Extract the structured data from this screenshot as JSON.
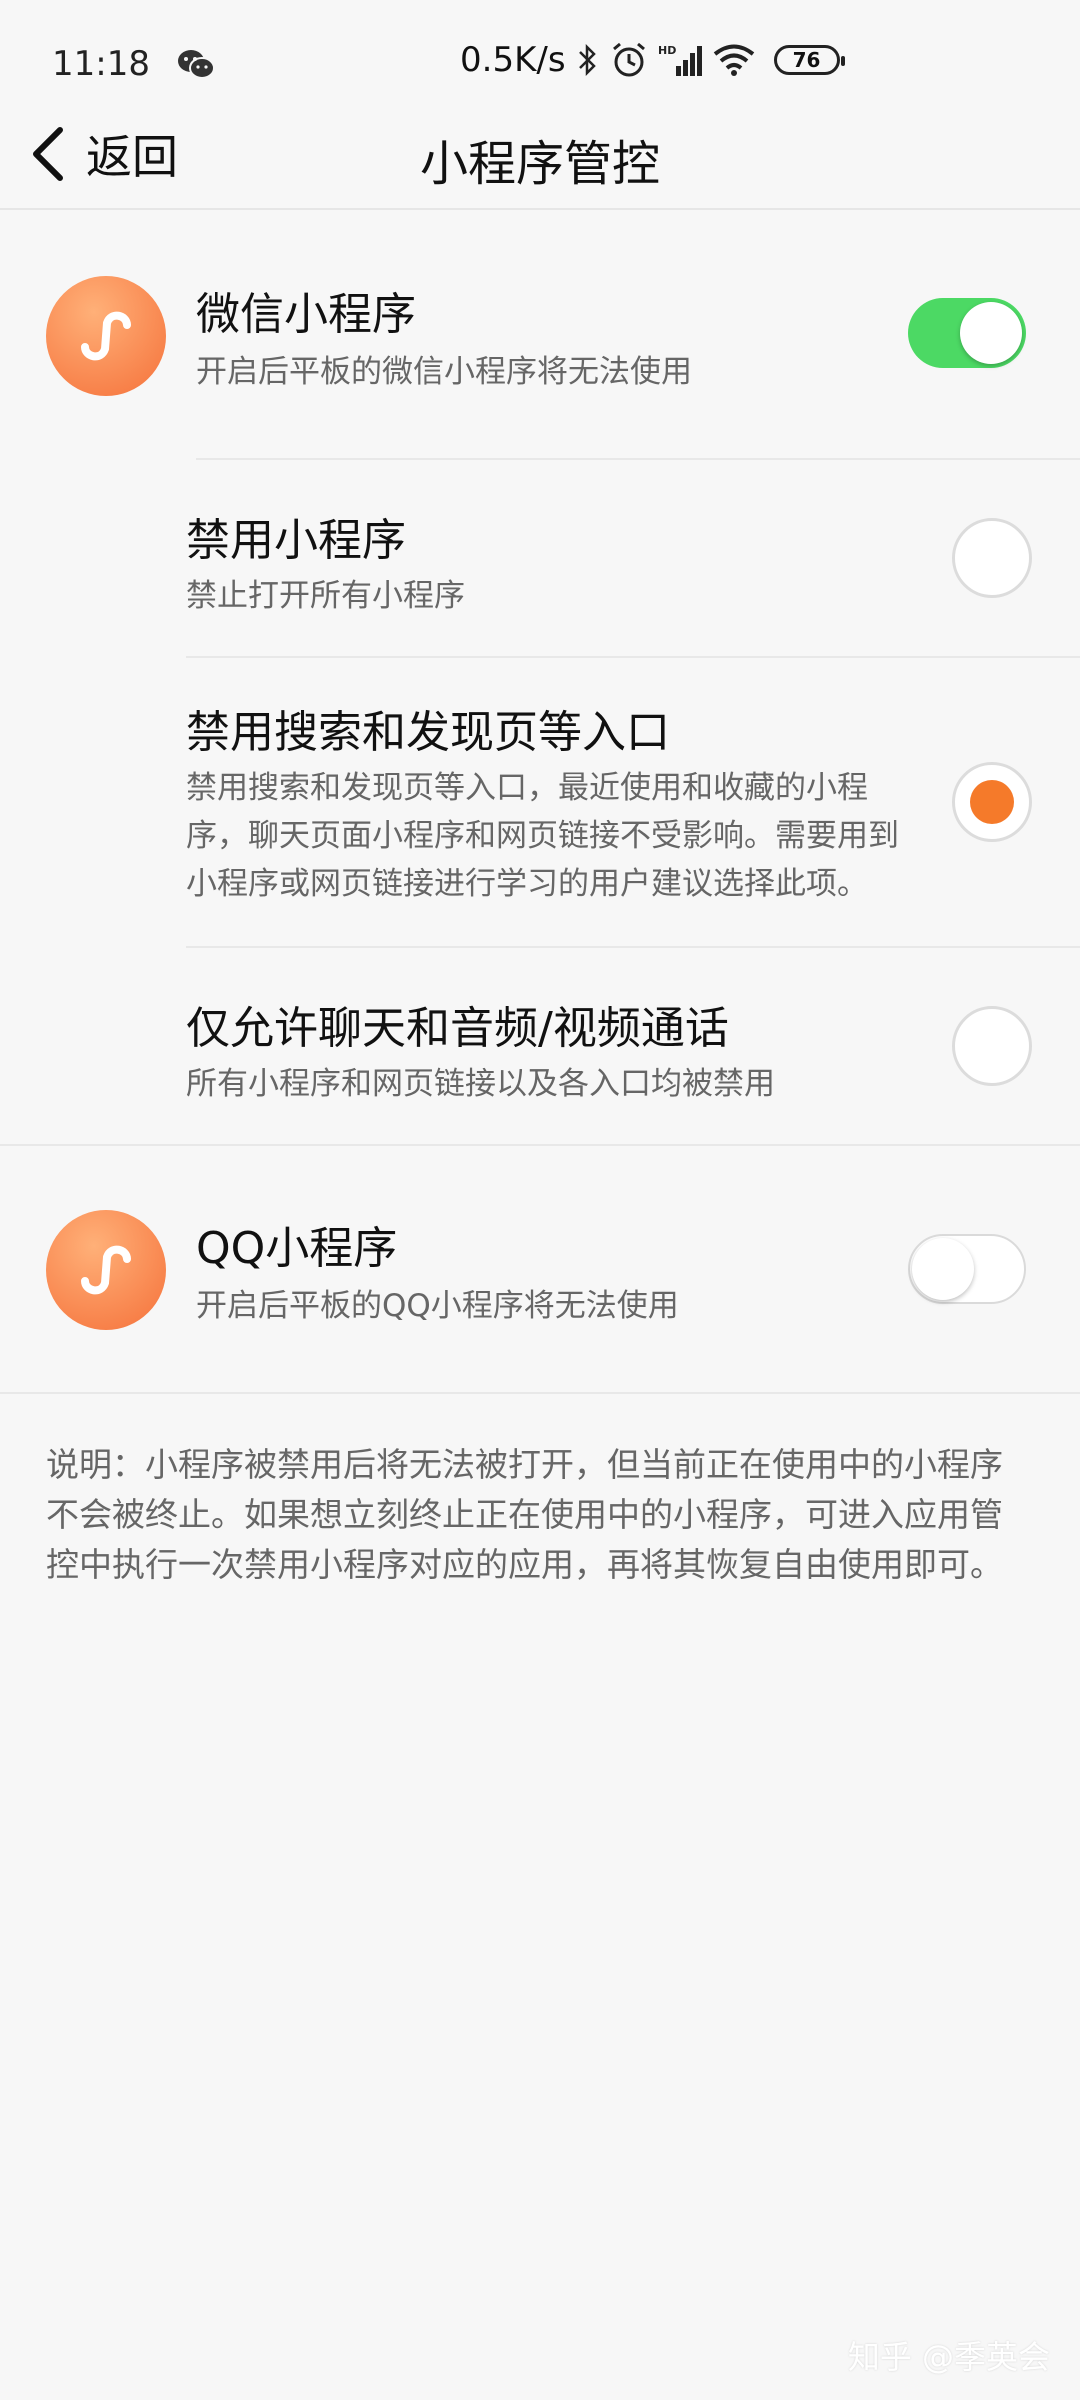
{
  "status_bar": {
    "time": "11:18",
    "network_speed": "0.5K/s",
    "battery": "76",
    "icons": [
      "wechat-icon",
      "bluetooth-icon",
      "alarm-icon",
      "hd-signal-icon",
      "wifi-icon",
      "battery-icon"
    ]
  },
  "header": {
    "back_label": "返回",
    "title": "小程序管控"
  },
  "wechat": {
    "title": "微信小程序",
    "subtitle": "开启后平板的微信小程序将无法使用",
    "enabled": true
  },
  "options": [
    {
      "title": "禁用小程序",
      "desc": "禁止打开所有小程序",
      "selected": false
    },
    {
      "title": "禁用搜索和发现页等入口",
      "desc_lines": [
        "禁用搜索和发现页等入口，最近使用和收藏的小程",
        "序，聊天页面小程序和网页链接不受影响。需要用到",
        "小程序或网页链接进行学习的用户建议选择此项。"
      ],
      "selected": true
    },
    {
      "title": "仅允许聊天和音频/视频通话",
      "desc": "所有小程序和网页链接以及各入口均被禁用",
      "selected": false
    }
  ],
  "qq": {
    "title": "QQ小程序",
    "subtitle": "开启后平板的QQ小程序将无法使用",
    "enabled": false
  },
  "note": {
    "lines": [
      "说明：小程序被禁用后将无法被打开，但当前正在使用中的小程序",
      "不会被终止。如果想立刻终止正在使用中的小程序，可进入应用管",
      "控中执行一次禁用小程序对应的应用，再将其恢复自由使用即可。"
    ]
  },
  "watermark": "知乎 @季英会",
  "colors": {
    "toggle_on": "#4cd964",
    "radio_selected": "#f57a2a",
    "icon_gradient": "#f5713a"
  }
}
